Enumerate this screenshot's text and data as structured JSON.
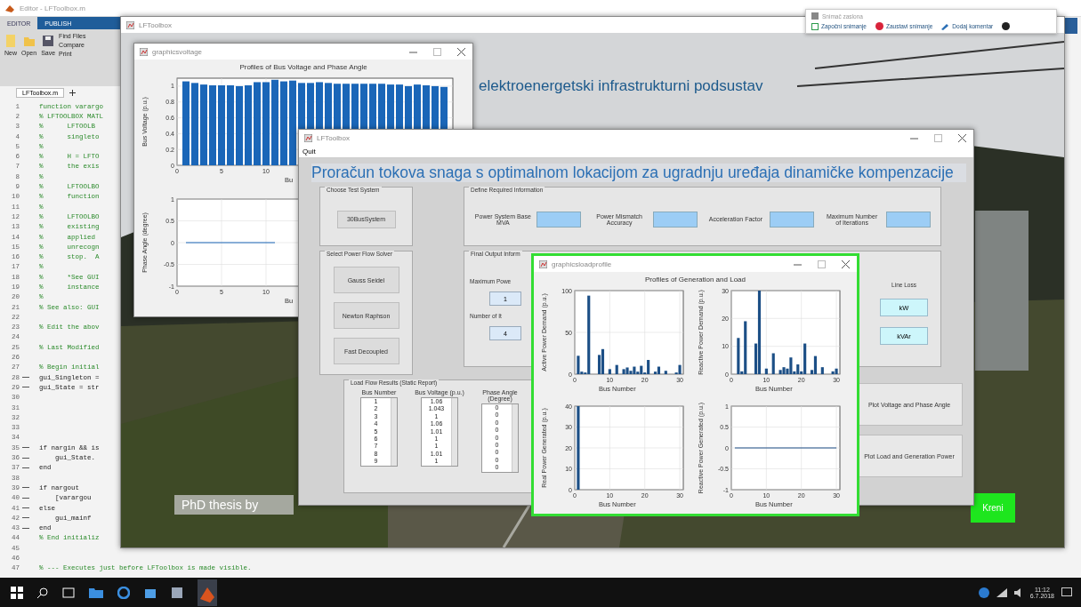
{
  "matlab": {
    "title": "Editor - LFToolbox.m",
    "ribbon_tabs": [
      {
        "label": "EDITOR",
        "selected": true
      },
      {
        "label": "PUBLISH",
        "selected": false
      }
    ],
    "big_buttons": [
      "New",
      "Open",
      "Save"
    ],
    "small_buttons": [
      "Find Files",
      "Compare",
      "Print"
    ],
    "file_tab": "LFToolbox.m",
    "code_lines": [
      {
        "number": "1",
        "code": "function varargo",
        "executable": false
      },
      {
        "number": "2",
        "code": "% LFTOOLBOX MATL",
        "executable": false
      },
      {
        "number": "3",
        "code": "%      LFTOOLB",
        "executable": false
      },
      {
        "number": "4",
        "code": "%      singleto",
        "executable": false
      },
      {
        "number": "5",
        "code": "%",
        "executable": false
      },
      {
        "number": "6",
        "code": "%      H = LFTO",
        "executable": false
      },
      {
        "number": "7",
        "code": "%      the exis",
        "executable": false
      },
      {
        "number": "8",
        "code": "%",
        "executable": false
      },
      {
        "number": "9",
        "code": "%      LFTOOLBO",
        "executable": false
      },
      {
        "number": "10",
        "code": "%      function",
        "executable": false
      },
      {
        "number": "11",
        "code": "%",
        "executable": false
      },
      {
        "number": "12",
        "code": "%      LFTOOLBO",
        "executable": false
      },
      {
        "number": "13",
        "code": "%      existing",
        "executable": false
      },
      {
        "number": "14",
        "code": "%      applied",
        "executable": false
      },
      {
        "number": "15",
        "code": "%      unrecogn",
        "executable": false
      },
      {
        "number": "16",
        "code": "%      stop.  A",
        "executable": false
      },
      {
        "number": "17",
        "code": "%",
        "executable": false
      },
      {
        "number": "18",
        "code": "%      *See GUI",
        "executable": false
      },
      {
        "number": "19",
        "code": "%      instance",
        "executable": false
      },
      {
        "number": "20",
        "code": "%",
        "executable": false
      },
      {
        "number": "21",
        "code": "% See also: GUI",
        "executable": false
      },
      {
        "number": "22",
        "executable": false
      },
      {
        "number": "23",
        "code": "% Edit the abov",
        "executable": false
      },
      {
        "number": "24",
        "executable": false
      },
      {
        "number": "25",
        "code": "% Last Modified",
        "executable": false
      },
      {
        "number": "26",
        "executable": false
      },
      {
        "number": "27",
        "code": "% Begin initial",
        "executable": false
      },
      {
        "number": "28",
        "code": "gui_Singleton =",
        "executable": true
      },
      {
        "number": "29",
        "code": "gui_State = str",
        "executable": true
      },
      {
        "number": "30",
        "executable": false
      },
      {
        "number": "31",
        "executable": false
      },
      {
        "number": "32",
        "executable": false
      },
      {
        "number": "33",
        "executable": false
      },
      {
        "number": "34",
        "executable": false
      },
      {
        "number": "35",
        "code": "if nargin && is",
        "executable": true
      },
      {
        "number": "36",
        "code": "    gui_State.",
        "executable": true
      },
      {
        "number": "37",
        "code": "end",
        "executable": true
      },
      {
        "number": "38",
        "executable": false
      },
      {
        "number": "39",
        "code": "if nargout",
        "executable": true
      },
      {
        "number": "40",
        "code": "    [varargou",
        "executable": true
      },
      {
        "number": "41",
        "code": "else",
        "executable": true
      },
      {
        "number": "42",
        "code": "    gui_mainf",
        "executable": true
      },
      {
        "number": "43",
        "code": "end",
        "executable": true
      },
      {
        "number": "44",
        "code": "% End initializ",
        "executable": false
      },
      {
        "number": "45",
        "executable": false
      },
      {
        "number": "46",
        "executable": false
      },
      {
        "number": "47",
        "code": "% --- Executes just before LFToolbox is made visible.",
        "executable": false
      }
    ]
  },
  "presentation": {
    "title": "LFToolbox",
    "heading": "elektroenergetski infrastrukturni podsustav",
    "caption": "PhD thesis by",
    "next_button": "Kreni"
  },
  "voltage_figure": {
    "title": "graphicsvoltage",
    "plot_title": "Profiles of Bus Voltage and Phase Angle",
    "axes": [
      {
        "chart_data": {
          "type": "bar",
          "xlabel": "Bu",
          "ylabel": "Bus Voltage (p.u.)",
          "x": [
            1,
            2,
            3,
            4,
            5,
            6,
            7,
            8,
            9,
            10,
            11,
            12,
            13,
            14,
            15,
            16,
            17,
            18,
            19,
            20,
            21,
            22,
            23,
            24,
            25,
            26,
            27,
            28,
            29,
            30
          ],
          "values": [
            1.06,
            1.04,
            1.02,
            1.01,
            1.01,
            1.01,
            1,
            1.01,
            1.05,
            1.05,
            1.08,
            1.06,
            1.07,
            1.04,
            1.04,
            1.05,
            1.04,
            1.03,
            1.03,
            1.03,
            1.03,
            1.03,
            1.03,
            1.02,
            1.02,
            1,
            1.02,
            1.01,
            1,
            0.99
          ],
          "grid": true,
          "xlim": [
            0,
            31
          ],
          "ylim": [
            0,
            1.1
          ],
          "xticks": [
            0,
            5,
            10
          ],
          "yticks": [
            0,
            0.2,
            0.4,
            0.6,
            0.8,
            1
          ]
        }
      },
      {
        "chart_data": {
          "type": "line",
          "xlabel": "Bu",
          "ylabel": "Phase Angle (degree)",
          "x": [
            1,
            11
          ],
          "values": [
            0,
            0
          ],
          "grid": true,
          "xlim": [
            0,
            31
          ],
          "ylim": [
            -1,
            1
          ],
          "xticks": [
            0,
            5,
            10
          ],
          "yticks": [
            -1,
            -0.5,
            0,
            0.5,
            1
          ]
        }
      }
    ]
  },
  "main_gui": {
    "title": "LFToolbox",
    "menu": [
      "Quit"
    ],
    "heading": "Proračun tokova snaga s optimalnom lokacijom za ugradnju uređaja dinamičke kompenzacije",
    "test_system": {
      "title": "Choose Test System",
      "button": "30BusSystem"
    },
    "required_info": {
      "title": "Define Required Information",
      "fields": [
        {
          "label": "Power System Base MVA"
        },
        {
          "label": "Power Mismatch Accuracy"
        },
        {
          "label": "Acceleration Factor"
        },
        {
          "label": "Maximum Number of Iterations"
        }
      ]
    },
    "solver": {
      "title": "Select Power Flow Solver",
      "buttons": [
        "Gauss Seidel",
        "Newton Raphson",
        "Fast Decoupled"
      ]
    },
    "output": {
      "title": "Final Output Inform",
      "fields": [
        {
          "label": "Maximum Powe",
          "value": "1"
        },
        {
          "label": "Number of It",
          "value": "4"
        }
      ],
      "loss_label": "Line Loss",
      "loss_fields": [
        "kW",
        "kVAr"
      ]
    },
    "results": {
      "title": "Load Flow Results (Static Report)",
      "columns": [
        {
          "heading": "Bus Number",
          "items": [
            "1",
            "2",
            "3",
            "4",
            "5",
            "6",
            "7",
            "8",
            "9"
          ]
        },
        {
          "heading": "Bus Voltage (p.u.)",
          "items": [
            "1.06",
            "1.043",
            "1",
            "1.06",
            "1.01",
            "1",
            "1",
            "1.01",
            "1"
          ]
        },
        {
          "heading": "Phase Angle (Degree)",
          "items": [
            "0",
            "0",
            "0",
            "0",
            "0",
            "0",
            "0",
            "0",
            "0"
          ]
        }
      ]
    },
    "plot_buttons": [
      "Plot Voltage and Phase Angle",
      "Plot Load and Generation Power"
    ]
  },
  "load_figure": {
    "title": "graphicsloadprofile",
    "highlighted": true,
    "plot_title": "Profiles of Generation and Load",
    "axes": [
      {
        "chart_data": {
          "type": "bar",
          "xlabel": "Bus Number",
          "ylabel": "Active Power Demand (p.u.)",
          "x": [
            1,
            2,
            3,
            4,
            5,
            6,
            7,
            8,
            9,
            10,
            11,
            12,
            13,
            14,
            15,
            16,
            17,
            18,
            19,
            20,
            21,
            22,
            23,
            24,
            25,
            26,
            27,
            28,
            29,
            30
          ],
          "values": [
            22,
            3,
            2,
            94,
            0,
            0,
            23,
            30,
            0,
            6,
            0,
            11,
            0,
            6,
            8,
            4,
            9,
            3,
            10,
            2,
            17,
            0,
            3,
            9,
            0,
            4,
            0,
            0,
            2,
            11
          ],
          "grid": true,
          "xlim": [
            0,
            31
          ],
          "ylim": [
            0,
            100
          ],
          "xticks": [
            0,
            10,
            20,
            30
          ],
          "yticks": [
            0,
            50,
            100
          ]
        }
      },
      {
        "chart_data": {
          "type": "bar",
          "xlabel": "Bus Number",
          "ylabel": "Reactive Power Demand (p.u.)",
          "x": [
            1,
            2,
            3,
            4,
            5,
            6,
            7,
            8,
            9,
            10,
            11,
            12,
            13,
            14,
            15,
            16,
            17,
            18,
            19,
            20,
            21,
            22,
            23,
            24,
            25,
            26,
            27,
            28,
            29,
            30
          ],
          "values": [
            0,
            13,
            1,
            19,
            0,
            0,
            11,
            30,
            0,
            2,
            0,
            7.5,
            0,
            1.5,
            2.5,
            2,
            6,
            1,
            3.5,
            1,
            11,
            0,
            1.5,
            6.5,
            0,
            2.5,
            0,
            0,
            1,
            2
          ],
          "grid": true,
          "xlim": [
            0,
            31
          ],
          "ylim": [
            0,
            30
          ],
          "xticks": [
            0,
            10,
            20,
            30
          ],
          "yticks": [
            0,
            10,
            20,
            30
          ]
        }
      },
      {
        "chart_data": {
          "type": "bar",
          "xlabel": "Bus Number",
          "ylabel": "Real Power Generated (p.u.)",
          "x": [
            1,
            2,
            3,
            4,
            5,
            6,
            7,
            8,
            9,
            10,
            11,
            12,
            13,
            14,
            15,
            16,
            17,
            18,
            19,
            20,
            21,
            22,
            23,
            24,
            25,
            26,
            27,
            28,
            29,
            30
          ],
          "values": [
            40,
            0,
            0,
            0,
            0,
            0,
            0,
            0,
            0,
            0,
            0,
            0,
            0,
            0,
            0,
            0,
            0,
            0,
            0,
            0,
            0,
            0,
            0,
            0,
            0,
            0,
            0,
            0,
            0,
            0
          ],
          "grid": true,
          "xlim": [
            0,
            31
          ],
          "ylim": [
            0,
            40
          ],
          "xticks": [
            0,
            10,
            20,
            30
          ],
          "yticks": [
            0,
            10,
            20,
            30,
            40
          ]
        }
      },
      {
        "chart_data": {
          "type": "line",
          "xlabel": "Bus Number",
          "ylabel": "Reactive Power Generated (p.u.)",
          "x": [
            1,
            30
          ],
          "values": [
            0,
            0
          ],
          "grid": true,
          "xlim": [
            0,
            31
          ],
          "ylim": [
            -1,
            1
          ],
          "xticks": [
            0,
            10,
            20,
            30
          ],
          "yticks": [
            -1,
            -0.5,
            0,
            0.5,
            1
          ]
        }
      }
    ]
  },
  "recorder": {
    "title": "Snimač zaslona",
    "items": [
      {
        "label": "Započni snimanje",
        "kind": "start"
      },
      {
        "label": "Zaustavi snimanje",
        "kind": "stop"
      },
      {
        "label": "Dodaj komentar",
        "kind": "comment"
      }
    ]
  },
  "taskbar": {
    "time": "11:12",
    "date": "6.7.2018"
  }
}
